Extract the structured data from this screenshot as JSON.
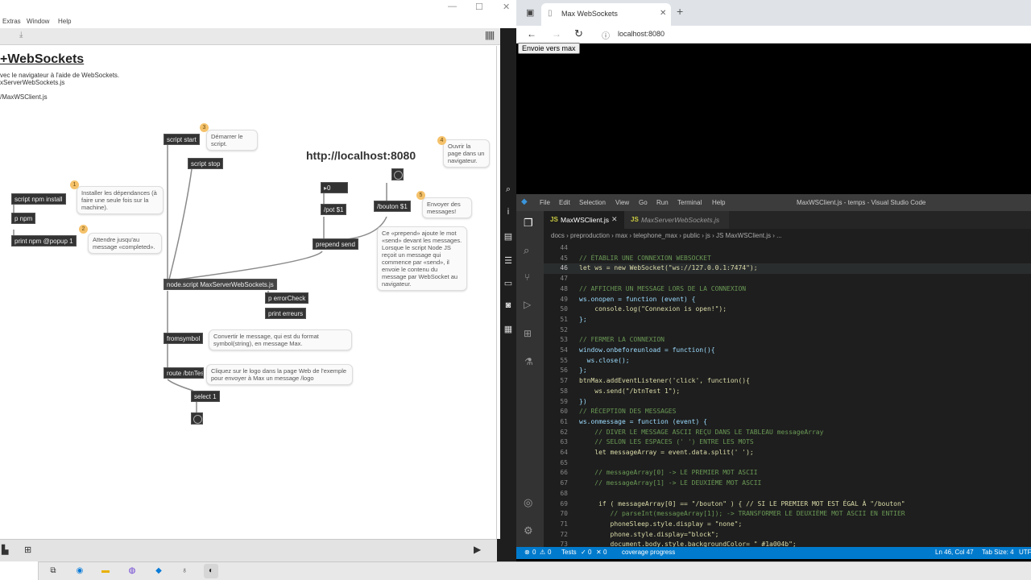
{
  "max": {
    "menu": [
      "Extras",
      "Window",
      "Help"
    ],
    "title": "+WebSockets",
    "desc_line1": "vec le navigateur à l'aide de WebSockets.",
    "desc_line2": "xServerWebSockets.js",
    "desc_line3": "/MaxWSClient.js",
    "url_label": "http://localhost:8080",
    "objects": {
      "script_start": "script start",
      "script_stop": "script stop",
      "npm_install": "script npm install",
      "p_npm": "p npm",
      "print_npm": "print npm @popup 1",
      "number_box": "0",
      "pot": "/pot $1",
      "bouton": "/bouton $1",
      "prepend": "prepend send",
      "node_script": "node.script MaxServerWebSockets.js",
      "p_error": "p errorCheck",
      "print_erreurs": "print erreurs",
      "fromsymbol": "fromsymbol",
      "route": "route /btnTest",
      "select": "select 1"
    },
    "comments": {
      "c1": "Installer les dépendances (à faire une seule fois sur la machine).",
      "c2": "Attendre jusqu'au message «completed».",
      "c3": "Démarrer le script.",
      "c4": "Ouvrir la page dans un navigateur.",
      "c5": "Envoyer des messages!",
      "prepend_note": "Ce «prepend» ajoute le mot «send» devant les messages. Lorsque le script Node JS reçoit un message qui commence par «send», il envoie le contenu du message par WebSocket au navigateur.",
      "convert_note": "Convertir le message, qui est du format symbol(string), en message Max.",
      "logo_note": "Cliquez sur le logo dans la page Web de l'exemple pour envoyer à Max un message /logo"
    },
    "badges": [
      "1",
      "2",
      "3",
      "4",
      "5"
    ]
  },
  "browser": {
    "tab_title": "Max WebSockets",
    "address": "localhost:8080",
    "send_button": "Envoie vers max"
  },
  "vscode": {
    "menu": [
      "File",
      "Edit",
      "Selection",
      "View",
      "Go",
      "Run",
      "Terminal",
      "Help"
    ],
    "window_title": "MaxWSClient.js - temps - Visual Studio Code",
    "tabs": [
      "MaxWSClient.js",
      "MaxServerWebSockets.js"
    ],
    "breadcrumb": "docs › preproduction › max › telephone_max › public › js › JS MaxWSClient.js › ...",
    "lines": [
      {
        "n": "44",
        "t": ""
      },
      {
        "n": "45",
        "t": "// ÉTABLIR UNE CONNEXION WEBSOCKET"
      },
      {
        "n": "46",
        "t": "let ws = new WebSocket(\"ws://127.0.0.1:7474\");"
      },
      {
        "n": "47",
        "t": ""
      },
      {
        "n": "48",
        "t": "// AFFICHER UN MESSAGE LORS DE LA CONNEXION"
      },
      {
        "n": "49",
        "t": "ws.onopen = function (event) {"
      },
      {
        "n": "50",
        "t": "    console.log(\"Connexion is open!\");"
      },
      {
        "n": "51",
        "t": "};"
      },
      {
        "n": "52",
        "t": ""
      },
      {
        "n": "53",
        "t": "// FERMER LA CONNEXION"
      },
      {
        "n": "54",
        "t": "window.onbeforeunload = function(){"
      },
      {
        "n": "55",
        "t": "  ws.close();"
      },
      {
        "n": "56",
        "t": "};"
      },
      {
        "n": "57",
        "t": "btnMax.addEventListener('click', function(){"
      },
      {
        "n": "58",
        "t": "    ws.send(\"/btnTest 1\");"
      },
      {
        "n": "59",
        "t": "})"
      },
      {
        "n": "60",
        "t": "// RÉCEPTION DES MESSAGES"
      },
      {
        "n": "61",
        "t": "ws.onmessage = function (event) {"
      },
      {
        "n": "62",
        "t": "    // DIVER LE MESSAGE ASCII REÇU DANS LE TABLEAU messageArray"
      },
      {
        "n": "63",
        "t": "    // SELON LES ESPACES (' ') ENTRE LES MOTS"
      },
      {
        "n": "64",
        "t": "    let messageArray = event.data.split(' ');"
      },
      {
        "n": "65",
        "t": ""
      },
      {
        "n": "66",
        "t": "    // messageArray[0] -> LE PREMIER MOT ASCII"
      },
      {
        "n": "67",
        "t": "    // messageArray[1] -> LE DEUXIÈME MOT ASCII"
      },
      {
        "n": "68",
        "t": ""
      },
      {
        "n": "69",
        "t": "     if ( messageArray[0] == \"/bouton\" ) { // SI LE PREMIER MOT EST ÉGAL À \"/bouton\""
      },
      {
        "n": "70",
        "t": "        // parseInt(messageArray[1]); -> TRANSFORMER LE DEUXIÈME MOT ASCII EN ENTIER"
      },
      {
        "n": "71",
        "t": "        phoneSleep.style.display = \"none\";"
      },
      {
        "n": "72",
        "t": "        phone.style.display=\"block\";"
      },
      {
        "n": "73",
        "t": "        document.body.style.backgroundColor= \" #1a004b\";"
      }
    ],
    "status": {
      "errors": "0",
      "warnings": "0",
      "tests": "Tests",
      "tests_pass": "0",
      "tests_fail": "0",
      "coverage": "coverage progress",
      "position": "Ln 46, Col 47",
      "tab_size": "Tab Size: 4",
      "encoding": "UTF"
    }
  },
  "colors": {
    "vs_status": "#007acc",
    "comment_green": "#6a9955",
    "string_orange": "#ce9178",
    "keyword_blue": "#569cd6",
    "badge_orange": "#f5c26b"
  }
}
